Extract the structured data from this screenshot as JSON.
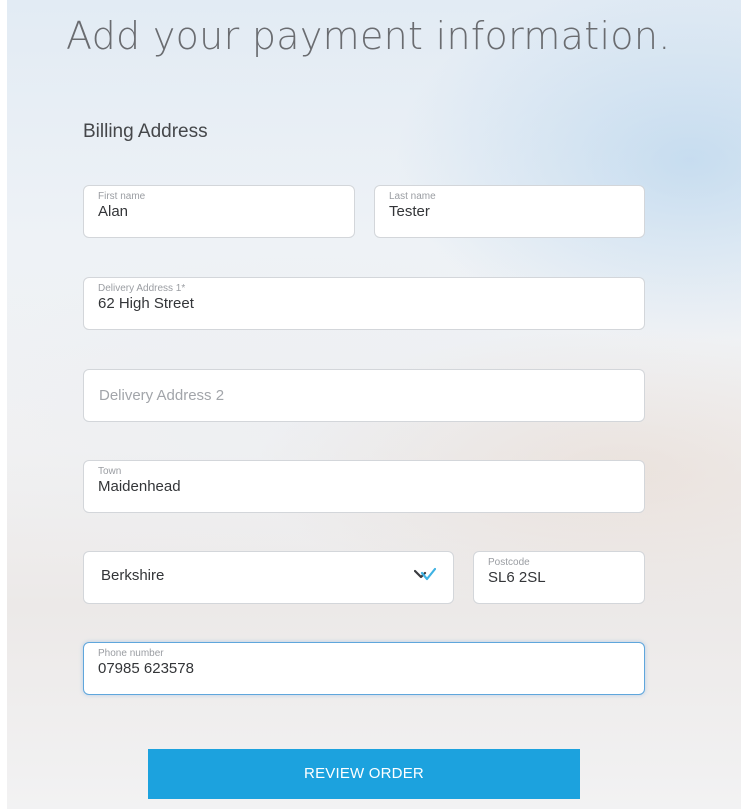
{
  "page": {
    "title": "Add your payment information."
  },
  "billing": {
    "section_title": "Billing Address",
    "first_name": {
      "label": "First name",
      "value": "Alan"
    },
    "last_name": {
      "label": "Last name",
      "value": "Tester"
    },
    "address1": {
      "label": "Delivery Address 1*",
      "value": "62 High Street"
    },
    "address2": {
      "placeholder": "Delivery Address 2",
      "value": ""
    },
    "town": {
      "label": "Town",
      "value": "Maidenhead"
    },
    "county": {
      "value": "Berkshire",
      "icon": "chevron-down-icon"
    },
    "postcode": {
      "label": "Postcode",
      "value": "SL6 2SL"
    },
    "phone": {
      "label": "Phone number",
      "value": "07985 623578"
    }
  },
  "actions": {
    "review_label": "REVIEW ORDER"
  },
  "colors": {
    "accent": "#1ca2de",
    "focus_border": "#5fa6dc"
  }
}
